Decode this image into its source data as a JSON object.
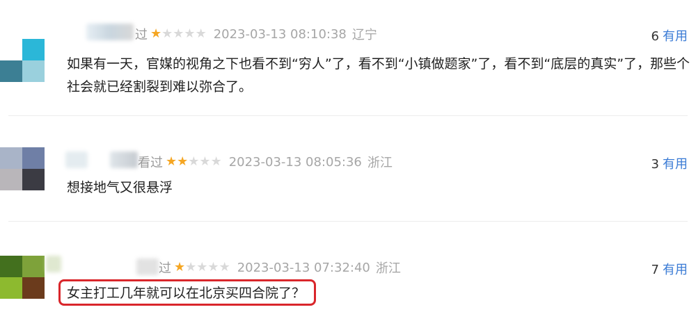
{
  "reviews": [
    {
      "status": "过",
      "stars": 1,
      "time": "2023-03-13 08:10:38",
      "region": "辽宁",
      "useful_count": "6",
      "useful_label": "有用",
      "content": "如果有一天，官媒的视角之下也看不到“穷人”了，看不到“小镇做题家”了，看不到“底层的真实”了，那些个社会就已经割裂到难以弥合了。",
      "avatar_colors": [
        "#ffffff",
        "#2bb7d8",
        "#3c7f94",
        "#9ad0dd"
      ],
      "highlighted": false
    },
    {
      "status": "看过",
      "stars": 2,
      "time": "2023-03-13 08:05:36",
      "region": "浙江",
      "useful_count": "3",
      "useful_label": "有用",
      "content": "想接地气又很悬浮",
      "avatar_colors": [
        "#a9b4c8",
        "#6f7fa6",
        "#b9b6ba",
        "#3b3b43"
      ],
      "highlighted": false
    },
    {
      "status": "过",
      "stars": 1,
      "time": "2023-03-13 07:32:40",
      "region": "浙江",
      "useful_count": "7",
      "useful_label": "有用",
      "content": "女主打工几年就可以在北京买四合院了？",
      "avatar_colors": [
        "#43701e",
        "#7ea23a",
        "#8dba2f",
        "#6b3b1c"
      ],
      "highlighted": true
    }
  ],
  "colors": {
    "star_on": "#f5a623",
    "star_off": "#d9d9d9",
    "useful_link": "#3a7bd5",
    "highlight_box": "#d9262b"
  },
  "icons": {
    "star": "star-icon"
  }
}
